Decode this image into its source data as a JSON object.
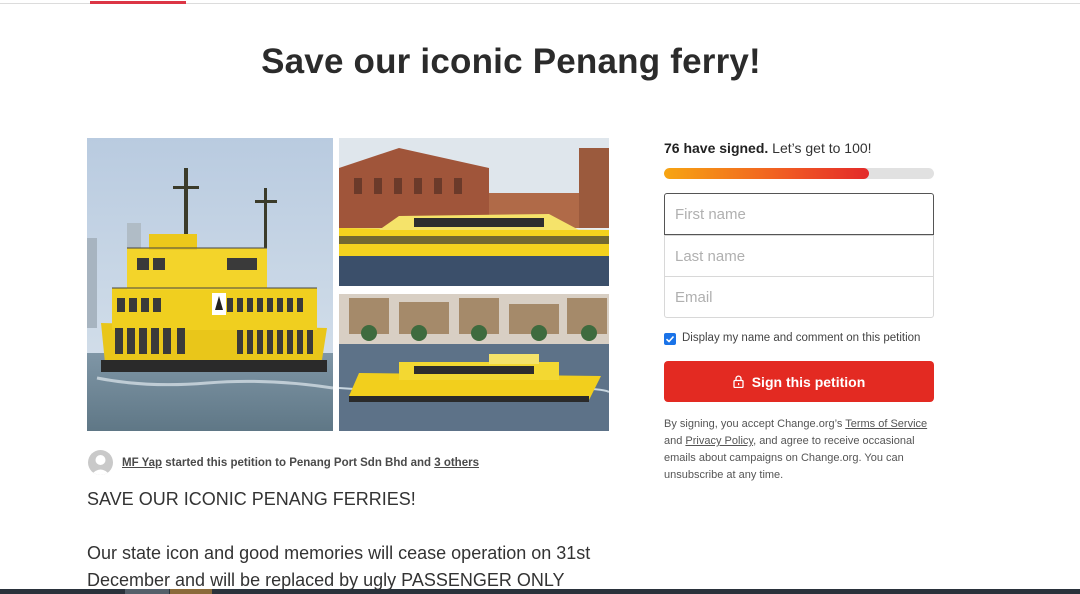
{
  "page": {
    "title": "Save our iconic Penang ferry!"
  },
  "author": {
    "name": "MF Yap",
    "middle": " started this petition to Penang Port Sdn Bhd and ",
    "others": "3 others"
  },
  "content": {
    "line1": "SAVE OUR ICONIC PENANG FERRIES!",
    "line2": "Our state icon and good memories will cease operation on 31st",
    "line3": "December and will be replaced by ugly PASSENGER ONLY"
  },
  "sign": {
    "signed": "76 have signed.",
    "goal_text": " Let’s get to 100!",
    "signed_count": 76,
    "goal": 100,
    "progress_fraction": 0.76,
    "first_name_placeholder": "First name",
    "last_name_placeholder": "Last name",
    "email_placeholder": "Email",
    "display_checkbox_label": "Display my name and comment on this petition",
    "display_checked": true,
    "button_label": "Sign this petition",
    "button_icon": "lock-icon",
    "legal_1": "By signing, you accept Change.org’s ",
    "terms": "Terms of Service",
    "legal_2": " and ",
    "privacy": "Privacy Policy",
    "legal_3": ", and agree to receive occasional emails about campaigns on Change.org. You can unsubscribe at any time."
  },
  "colors": {
    "accent_red": "#e32a22",
    "checkbox_blue": "#1a73e8",
    "ferry_yellow": "#f2cf1d"
  }
}
